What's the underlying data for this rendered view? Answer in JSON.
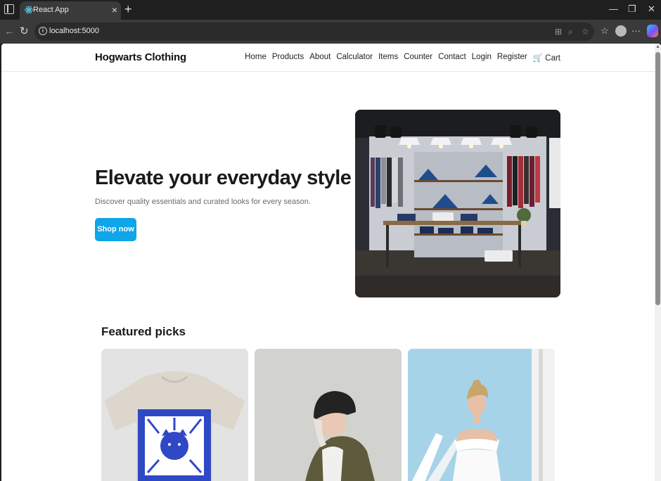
{
  "browser": {
    "tab_title": "React App",
    "tab_close": "×",
    "new_tab": "+",
    "url": "localhost:5000",
    "window_controls": {
      "minimize": "—",
      "restore": "❐",
      "close": "✕"
    },
    "more_menu": "···"
  },
  "site": {
    "brand": "Hogwarts Clothing",
    "nav": [
      "Home",
      "Products",
      "About",
      "Calculator",
      "Items",
      "Counter",
      "Contact",
      "Login",
      "Register",
      "🛒 Cart"
    ]
  },
  "hero": {
    "title": "Elevate your everyday style",
    "subtitle": "Discover quality essentials and curated looks for every season.",
    "cta": "Shop now"
  },
  "featured": {
    "title": "Featured picks"
  },
  "colors": {
    "accent": "#0ea5e9",
    "chrome_dark": "#1f1f1f",
    "chrome_toolbar": "#3a3a3a"
  }
}
